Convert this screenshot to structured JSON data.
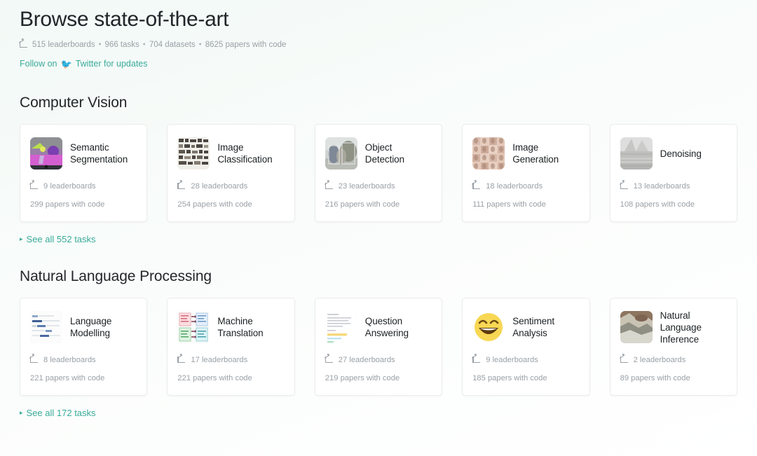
{
  "header": {
    "title": "Browse state-of-the-art",
    "stats": [
      "515 leaderboards",
      "966 tasks",
      "704 datasets",
      "8625 papers with code"
    ],
    "stats_icon": "chart-line-up-icon",
    "follow_prefix": "Follow on",
    "follow_icon": "twitter-bird-icon",
    "follow_suffix": "Twitter for updates",
    "link_color": "#3aab9a"
  },
  "sections": [
    {
      "title": "Computer Vision",
      "see_all": "See all 552 tasks",
      "cards": [
        {
          "title": "Semantic Segmentation",
          "leaderboards": "9 leaderboards",
          "papers": "299 papers with code",
          "thumb": "semantic-segmentation-thumbnail"
        },
        {
          "title": "Image Classification",
          "leaderboards": "28 leaderboards",
          "papers": "254 papers with code",
          "thumb": "image-classification-thumbnail"
        },
        {
          "title": "Object Detection",
          "leaderboards": "23 leaderboards",
          "papers": "216 papers with code",
          "thumb": "object-detection-thumbnail"
        },
        {
          "title": "Image Generation",
          "leaderboards": "18 leaderboards",
          "papers": "111 papers with code",
          "thumb": "image-generation-thumbnail"
        },
        {
          "title": "Denoising",
          "leaderboards": "13 leaderboards",
          "papers": "108 papers with code",
          "thumb": "denoising-thumbnail"
        }
      ]
    },
    {
      "title": "Natural Language Processing",
      "see_all": "See all 172 tasks",
      "cards": [
        {
          "title": "Language Modelling",
          "leaderboards": "8 leaderboards",
          "papers": "221 papers with code",
          "thumb": "language-modelling-thumbnail"
        },
        {
          "title": "Machine Translation",
          "leaderboards": "17 leaderboards",
          "papers": "221 papers with code",
          "thumb": "machine-translation-thumbnail"
        },
        {
          "title": "Question Answering",
          "leaderboards": "27 leaderboards",
          "papers": "219 papers with code",
          "thumb": "question-answering-thumbnail"
        },
        {
          "title": "Sentiment Analysis",
          "leaderboards": "9 leaderboards",
          "papers": "185 papers with code",
          "thumb": "sentiment-analysis-thumbnail"
        },
        {
          "title": "Natural Language Inference",
          "leaderboards": "2 leaderboards",
          "papers": "89 papers with code",
          "thumb": "natural-language-inference-thumbnail"
        }
      ]
    }
  ]
}
